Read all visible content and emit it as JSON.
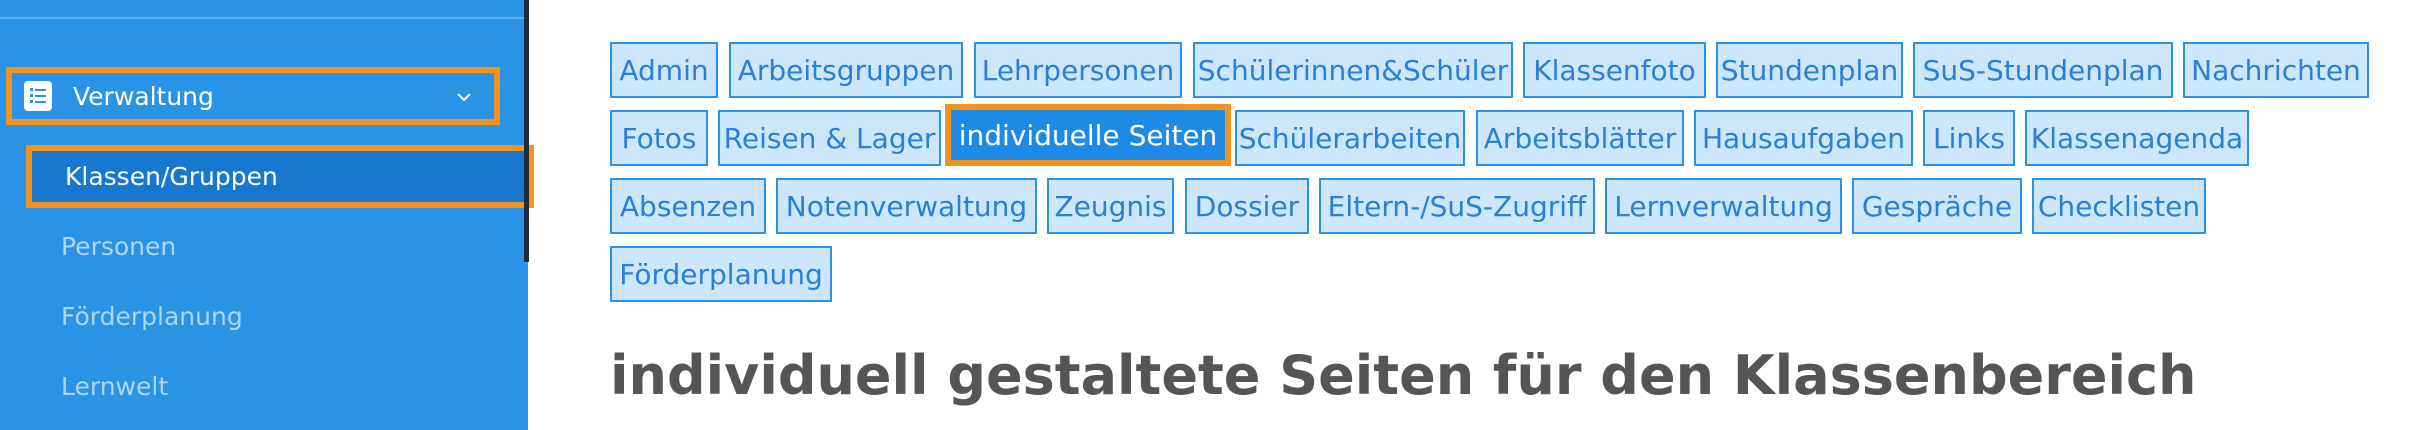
{
  "sidebar": {
    "main_item": {
      "label": "Verwaltung",
      "icon": "checklist-icon",
      "chevron": "chevron-down-icon"
    },
    "sub_item": {
      "label": "Klassen/Gruppen"
    },
    "items": [
      {
        "label": "Personen"
      },
      {
        "label": "Förderplanung"
      },
      {
        "label": "Lernwelt"
      }
    ]
  },
  "tabs": [
    {
      "label": "Admin"
    },
    {
      "label": "Arbeitsgruppen"
    },
    {
      "label": "Lehrpersonen"
    },
    {
      "label": "Schülerinnen&Schüler"
    },
    {
      "label": "Klassenfoto"
    },
    {
      "label": "Stundenplan"
    },
    {
      "label": "SuS-Stundenplan"
    },
    {
      "label": "Nachrichten"
    },
    {
      "label": "Fotos"
    },
    {
      "label": "Reisen & Lager"
    },
    {
      "label": "individuelle Seiten",
      "active": true
    },
    {
      "label": "Schülerarbeiten"
    },
    {
      "label": "Arbeitsblätter"
    },
    {
      "label": "Hausaufgaben"
    },
    {
      "label": "Links"
    },
    {
      "label": "Klassenagenda"
    },
    {
      "label": "Absenzen"
    },
    {
      "label": "Notenverwaltung"
    },
    {
      "label": "Zeugnis"
    },
    {
      "label": "Dossier"
    },
    {
      "label": "Eltern-/SuS-Zugriff"
    },
    {
      "label": "Lernverwaltung"
    },
    {
      "label": "Gespräche"
    },
    {
      "label": "Checklisten"
    },
    {
      "label": "Förderplanung"
    }
  ],
  "page": {
    "title": "individuell gestaltete Seiten für den Klassenbereich"
  },
  "colors": {
    "sidebar_bg": "#2b93e6",
    "highlight_outline": "#f3931f",
    "tag_bg": "#cce6fb",
    "tag_border": "#2b93e6",
    "tag_active_bg": "#1f8ae6",
    "heading": "#555555"
  }
}
